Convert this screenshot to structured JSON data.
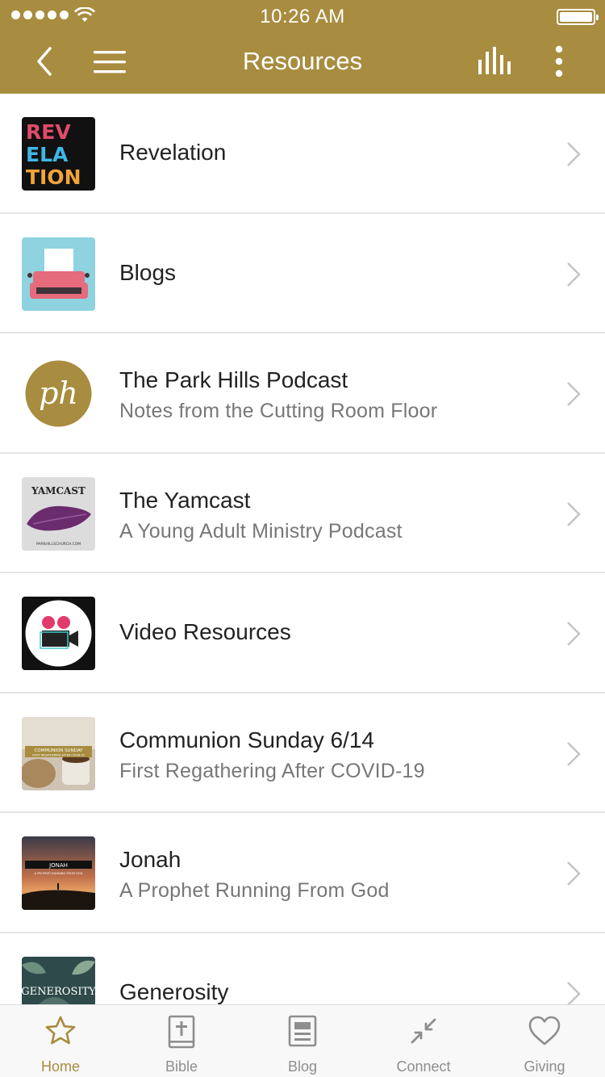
{
  "status_bar": {
    "time": "10:26 AM"
  },
  "nav": {
    "title": "Resources"
  },
  "items": [
    {
      "title": "Revelation",
      "subtitle": "",
      "thumb_text": "REV ELA TION"
    },
    {
      "title": "Blogs",
      "subtitle": ""
    },
    {
      "title": "The Park Hills Podcast",
      "subtitle": "Notes from the Cutting Room Floor",
      "thumb_text": "ph"
    },
    {
      "title": "The Yamcast",
      "subtitle": "A Young Adult Ministry Podcast",
      "thumb_text": "YAMCAST",
      "thumb_small": "PARKHILLSCHURCH.COM"
    },
    {
      "title": "Video Resources",
      "subtitle": ""
    },
    {
      "title": "Communion Sunday 6/14",
      "subtitle": "First Regathering After COVID-19",
      "thumb_text": "COMMUNION SUNDAY",
      "thumb_small": "FIRST REGATHERING AFTER COVID-19"
    },
    {
      "title": "Jonah",
      "subtitle": "A Prophet Running From God",
      "thumb_text": "JONAH",
      "thumb_small": "A PROPHET RUNNING FROM GOD"
    },
    {
      "title": "Generosity",
      "subtitle": "",
      "thumb_text": "GENEROSITY"
    }
  ],
  "tabs": [
    {
      "label": "Home",
      "icon": "star-icon",
      "active": true
    },
    {
      "label": "Bible",
      "icon": "bible-icon",
      "active": false
    },
    {
      "label": "Blog",
      "icon": "blog-icon",
      "active": false
    },
    {
      "label": "Connect",
      "icon": "connect-icon",
      "active": false
    },
    {
      "label": "Giving",
      "icon": "heart-icon",
      "active": false
    }
  ],
  "colors": {
    "brand": "#a88c3f",
    "tab_inactive": "#8e8e8e",
    "divider": "#e4e4e4"
  }
}
